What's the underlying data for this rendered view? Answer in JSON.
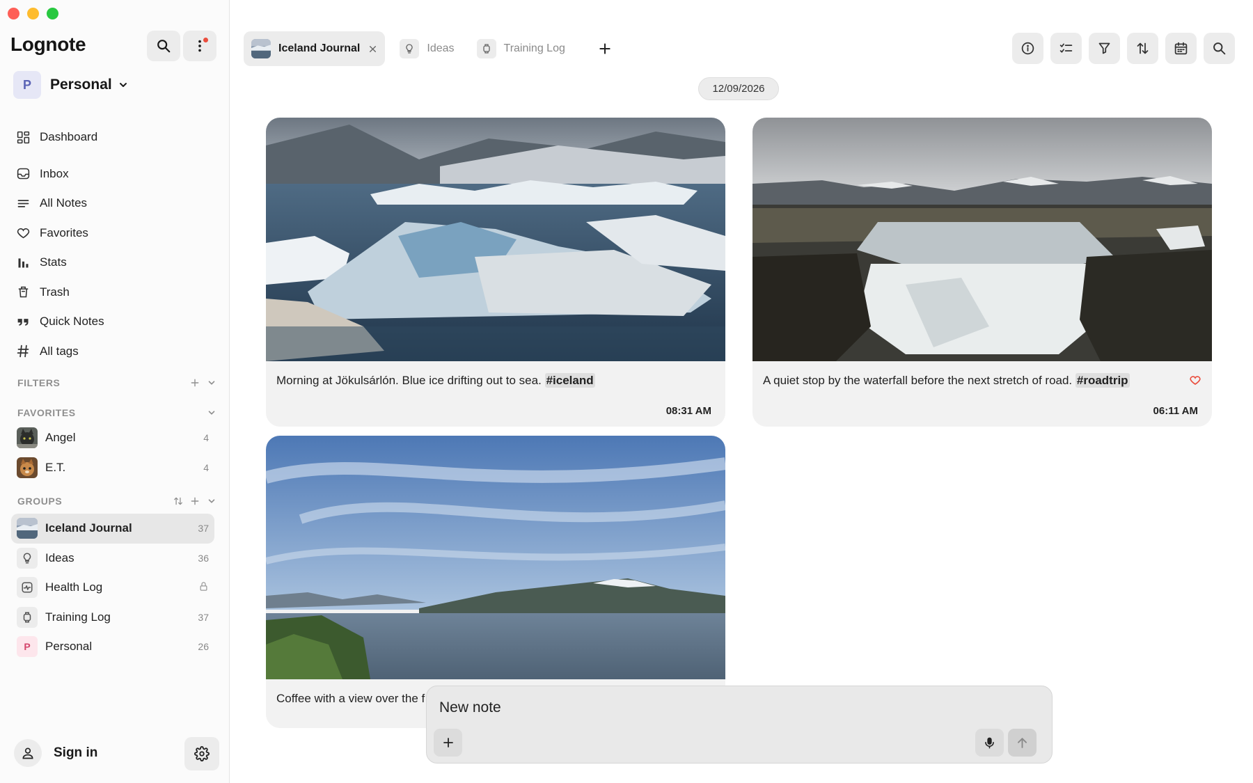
{
  "app": {
    "title": "Lognote"
  },
  "workspace": {
    "initial": "P",
    "name": "Personal"
  },
  "nav": [
    {
      "label": "Dashboard",
      "icon": "dashboard-icon"
    },
    {
      "label": "Inbox",
      "icon": "inbox-icon"
    },
    {
      "label": "All Notes",
      "icon": "list-icon"
    },
    {
      "label": "Favorites",
      "icon": "heart-icon"
    },
    {
      "label": "Stats",
      "icon": "bar-chart-icon"
    },
    {
      "label": "Trash",
      "icon": "trash-icon"
    },
    {
      "label": "Quick Notes",
      "icon": "quote-icon"
    },
    {
      "label": "All tags",
      "icon": "hash-icon"
    }
  ],
  "filters": {
    "label": "FILTERS"
  },
  "favorites": {
    "label": "FAVORITES",
    "items": [
      {
        "label": "Angel",
        "count": "4"
      },
      {
        "label": "E.T.",
        "count": "4"
      }
    ]
  },
  "groups": {
    "label": "GROUPS",
    "items": [
      {
        "label": "Iceland Journal",
        "count": "37"
      },
      {
        "label": "Ideas",
        "count": "36"
      },
      {
        "label": "Health Log",
        "count": ""
      },
      {
        "label": "Training Log",
        "count": "37"
      },
      {
        "label": "Personal",
        "count": "26",
        "initial": "P"
      }
    ]
  },
  "account": {
    "signin_label": "Sign in"
  },
  "tabs": [
    {
      "label": "Iceland Journal",
      "active": true
    },
    {
      "label": "Ideas",
      "active": false
    },
    {
      "label": "Training Log",
      "active": false
    }
  ],
  "toolbar": [
    "info-icon",
    "checklist-icon",
    "filter-icon",
    "sort-icon",
    "calendar-icon",
    "search-icon"
  ],
  "date_pill": "12/09/2026",
  "notes": [
    {
      "text": "Morning at Jökulsárlón. Blue ice drifting out to sea.",
      "tag": "#iceland",
      "time": "08:31 AM",
      "favorite": false
    },
    {
      "text": "A quiet stop by the waterfall before the next stretch of road.",
      "tag": "#roadtrip",
      "time": "06:11 AM",
      "favorite": true
    },
    {
      "text": "Coffee with a view over the f",
      "tag": "",
      "time": "",
      "favorite": false
    }
  ],
  "composer": {
    "placeholder": "New note"
  },
  "colors": {
    "accent_red": "#ea4d3d",
    "active_bg": "#e7e7e7",
    "card_bg": "#f2f2f2",
    "workspace_avatar": "#5a62b5"
  }
}
